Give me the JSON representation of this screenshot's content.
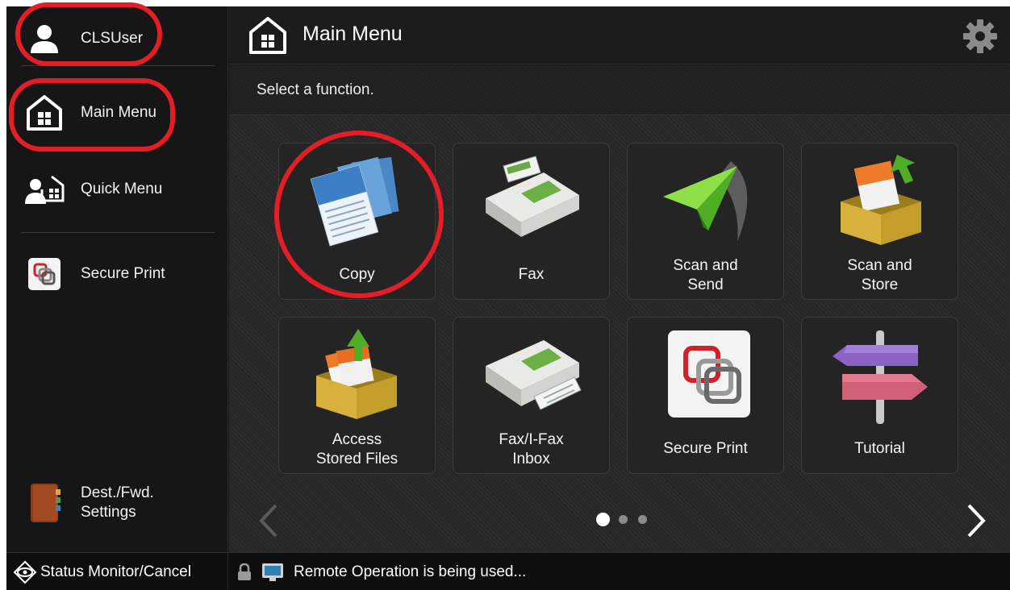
{
  "sidebar": {
    "user": {
      "label": "CLSUser",
      "icon": "user-icon"
    },
    "main_menu": {
      "label": "Main Menu",
      "icon": "home-icon"
    },
    "quick_menu": {
      "label": "Quick Menu",
      "icon": "quick-menu-icon"
    },
    "secure_print": {
      "label": "Secure Print",
      "icon": "secure-print-icon"
    },
    "dest_settings": {
      "label": "Dest./Fwd.\nSettings",
      "icon": "address-book-icon"
    }
  },
  "header": {
    "title": "Main Menu",
    "settings_icon": "gear-icon"
  },
  "content": {
    "instruction": "Select a function.",
    "tiles": [
      {
        "label": "Copy",
        "icon": "copy-icon"
      },
      {
        "label": "Fax",
        "icon": "fax-icon"
      },
      {
        "label": "Scan and\nSend",
        "icon": "scan-send-icon"
      },
      {
        "label": "Scan and\nStore",
        "icon": "scan-store-icon"
      },
      {
        "label": "Access\nStored Files",
        "icon": "stored-files-icon"
      },
      {
        "label": "Fax/I-Fax\nInbox",
        "icon": "fax-inbox-icon"
      },
      {
        "label": "Secure Print",
        "icon": "secure-print-icon"
      },
      {
        "label": "Tutorial",
        "icon": "signpost-icon"
      }
    ],
    "pagination": {
      "current_page": 1,
      "total_pages": 3
    }
  },
  "footer": {
    "status_monitor": "Status Monitor/Cancel",
    "remote_message": "Remote Operation is being used..."
  },
  "colors": {
    "annotation": "#e41e26",
    "background": "#1a1a1a"
  }
}
